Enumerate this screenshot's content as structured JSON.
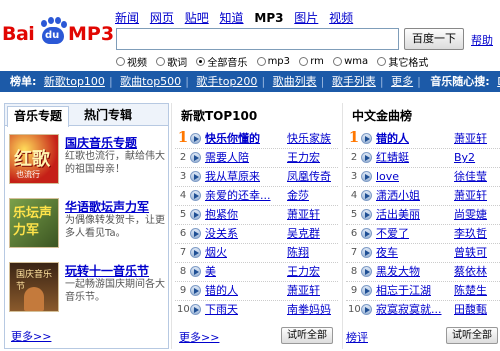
{
  "logo": {
    "text_left": "Bai",
    "text_paw": "du",
    "text_right": "MP3"
  },
  "topnav": [
    "新闻",
    "网页",
    "贴吧",
    "知道",
    "MP3",
    "图片",
    "视频"
  ],
  "search": {
    "value": "",
    "button": "百度一下",
    "help": "帮助"
  },
  "filters": [
    {
      "label": "视频",
      "checked": false
    },
    {
      "label": "歌词",
      "checked": false
    },
    {
      "label": "全部音乐",
      "checked": true
    },
    {
      "label": "mp3",
      "checked": false
    },
    {
      "label": "rm",
      "checked": false
    },
    {
      "label": "wma",
      "checked": false
    },
    {
      "label": "其它格式",
      "checked": false
    }
  ],
  "rankbar": {
    "title": "榜单:",
    "items": [
      "新歌top100",
      "歌曲top500",
      "歌手top200",
      "歌曲列表",
      "歌手列表",
      "更多"
    ],
    "strong": "音乐随心搜:",
    "tail": "DJ"
  },
  "left": {
    "tabs": [
      "音乐专题",
      "热门专辑"
    ],
    "features": [
      {
        "title": "国庆音乐专题",
        "desc": "红歌也流行，献给伟大的祖国母亲！",
        "thumb_big": "红歌",
        "thumb_small": "也流行"
      },
      {
        "title": "华语歌坛声力军",
        "desc": "为偶像转发贺卡，让更多人看见Ta。",
        "thumb_big": "乐坛声力军"
      },
      {
        "title": "玩转十一音乐节",
        "desc": "一起畅游国庆期间各大音乐节。",
        "thumb_big": "国庆音乐节"
      }
    ],
    "more": "更多>>"
  },
  "newtop": {
    "title": "新歌TOP100",
    "rows": [
      {
        "num": "1",
        "song": "快乐你懂的",
        "artist": "快乐家族",
        "hot": true
      },
      {
        "num": "2",
        "song": "需要人陪",
        "artist": "王力宏"
      },
      {
        "num": "3",
        "song": "我从草原来",
        "artist": "凤凰传奇"
      },
      {
        "num": "4",
        "song": "亲爱的还幸...",
        "artist": "金莎"
      },
      {
        "num": "5",
        "song": "抱紧你",
        "artist": "萧亚轩"
      },
      {
        "num": "6",
        "song": "没关系",
        "artist": "吴克群"
      },
      {
        "num": "7",
        "song": "烟火",
        "artist": "陈翔"
      },
      {
        "num": "8",
        "song": "美",
        "artist": "王力宏"
      },
      {
        "num": "9",
        "song": "错的人",
        "artist": "萧亚轩"
      },
      {
        "num": "10",
        "song": "下雨天",
        "artist": "南拳妈妈"
      }
    ],
    "more": "更多>>",
    "listen_all": "试听全部"
  },
  "cntop": {
    "title": "中文金曲榜",
    "rows": [
      {
        "num": "1",
        "song": "错的人",
        "artist": "萧亚轩",
        "hot": true
      },
      {
        "num": "2",
        "song": "红蜻蜓",
        "artist": "By2"
      },
      {
        "num": "3",
        "song": "love",
        "artist": "徐佳莹"
      },
      {
        "num": "4",
        "song": "潇洒小姐",
        "artist": "萧亚轩"
      },
      {
        "num": "5",
        "song": "活出美丽",
        "artist": "尚雯婕"
      },
      {
        "num": "6",
        "song": "不爱了",
        "artist": "李玖哲"
      },
      {
        "num": "7",
        "song": "夜车",
        "artist": "曾轶可"
      },
      {
        "num": "8",
        "song": "黑发大物",
        "artist": "蔡依林"
      },
      {
        "num": "9",
        "song": "相忘于江湖",
        "artist": "陈楚生"
      },
      {
        "num": "10",
        "song": "寂寞寂寞就...",
        "artist": "田馥甄"
      }
    ],
    "more": "榜评",
    "listen_all": "试听全部"
  }
}
